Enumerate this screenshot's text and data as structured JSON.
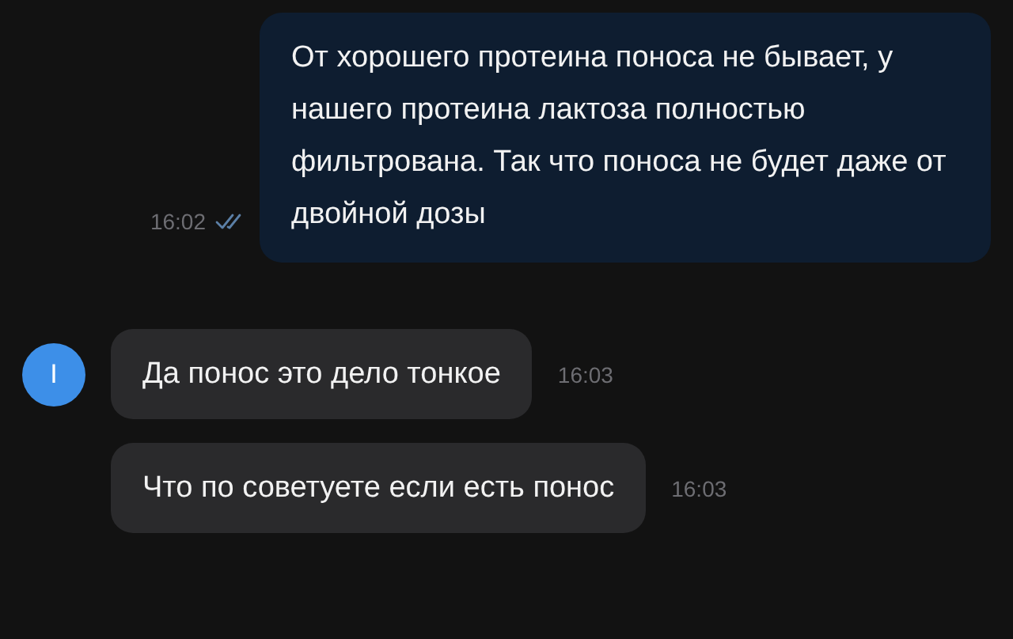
{
  "messages": [
    {
      "kind": "outgoing",
      "text": "От хорошего протеина поноса не бывает, у нашего протеина лактоза полностью фильтрована. Так что поноса не будет даже от двойной дозы",
      "time": "16:02",
      "read": true
    },
    {
      "kind": "incoming",
      "avatar": "I",
      "text": "Да понос это дело тонкое",
      "time": "16:03"
    },
    {
      "kind": "incoming",
      "text": "Что по советуете если есть понос",
      "time": "16:03"
    }
  ]
}
